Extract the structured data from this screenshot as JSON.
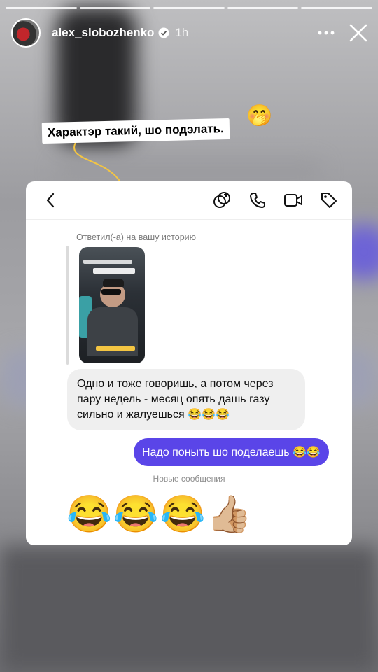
{
  "story": {
    "username": "alex_slobozhenko",
    "time": "1h",
    "progress_segments": 5,
    "caption": "Характэр такий, шо подэлать.",
    "caption_emoji": "🤭"
  },
  "chat": {
    "reply_label": "Ответил(-а) на вашу историю",
    "incoming_message": "Одно и тоже говоришь, а потом  через пару недель - месяц опять дашь газу сильно и жалуешься 😂😂😂",
    "outgoing_message": "Надо поныть шо поделаешь 😂😂",
    "new_messages_label": "Новые сообщения",
    "big_emoji": "😂😂😂👍🏼"
  },
  "colors": {
    "accent": "#5a45e8",
    "caption_line": "#f4c542"
  },
  "icons": [
    "verified-icon",
    "more-icon",
    "close-icon",
    "back-icon",
    "ai-icon",
    "phone-icon",
    "video-icon",
    "tag-icon"
  ]
}
